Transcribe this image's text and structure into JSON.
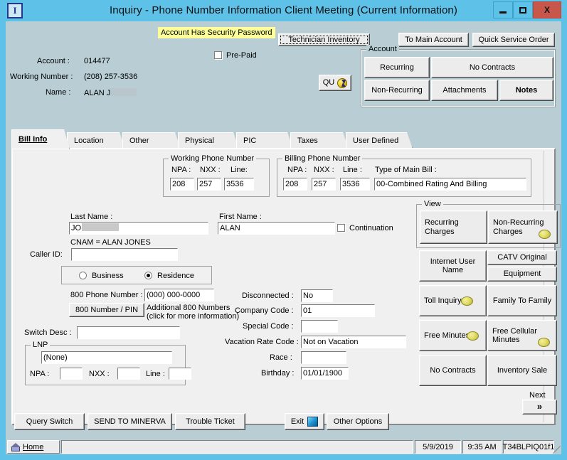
{
  "window": {
    "title": "Inquiry - Phone Number Information    Client Meeting  (Current Information)",
    "app_icon": "I",
    "minimize": "minimize-icon",
    "maximize": "maximize-icon",
    "close": "X"
  },
  "header": {
    "security_banner": "Account Has Security Password",
    "prepaid_label": "Pre-Paid",
    "technician_inventory": "Technician Inventory",
    "to_main_account": "To Main Account",
    "quick_service_order": "Quick Service Order",
    "qu_button": "QU",
    "account_label": "Account :",
    "account_value": "014477",
    "working_number_label": "Working Number :",
    "working_number_value": "(208) 257-3536",
    "name_label": "Name :",
    "name_value": "ALAN J"
  },
  "account_group": {
    "legend": "Account",
    "buttons": [
      "Recurring",
      "No Contracts",
      "Non-Recurring",
      "Attachments",
      "Notes"
    ]
  },
  "tabs": [
    {
      "label": "Bill Info",
      "active": true
    },
    {
      "label": "Location",
      "active": false
    },
    {
      "label": "Other",
      "active": false
    },
    {
      "label": "Physical",
      "active": false
    },
    {
      "label": "PIC",
      "active": false
    },
    {
      "label": "Taxes",
      "active": false
    },
    {
      "label": "User Defined",
      "active": false
    }
  ],
  "working_phone": {
    "legend": "Working Phone Number",
    "npa_label": "NPA :",
    "nxx_label": "NXX :",
    "line_label": "Line:",
    "npa": "208",
    "nxx": "257",
    "line": "3536"
  },
  "billing_phone": {
    "legend": "Billing Phone Number",
    "npa_label": "NPA :",
    "nxx_label": "NXX :",
    "line_label": "Line :",
    "type_label": "Type of Main Bill :",
    "npa": "208",
    "nxx": "257",
    "line": "3536",
    "type_value": "00-Combined Rating And Billing"
  },
  "names": {
    "last_name_label": "Last Name :",
    "last_name_value": "JO",
    "first_name_label": "First Name :",
    "first_name_value": "ALAN",
    "continuation_label": "Continuation",
    "cnam_text": "CNAM = ALAN JONES",
    "caller_id_label": "Caller ID:",
    "caller_id_value": ""
  },
  "class": {
    "business": "Business",
    "residence": "Residence",
    "selected": "Residence"
  },
  "eight_hundred": {
    "phone_label": "800 Phone Number :",
    "phone_value": "(000) 000-0000",
    "pin_button": "800 Number / PIN",
    "note_line1": "Additional 800 Numbers",
    "note_line2": "(click for more information)"
  },
  "switch": {
    "label": "Switch Desc :",
    "value": ""
  },
  "lnp": {
    "legend": "LNP",
    "value": "(None)",
    "npa_label": "NPA :",
    "nxx_label": "NXX :",
    "line_label": "Line :",
    "npa": "",
    "nxx": "",
    "line": ""
  },
  "details": {
    "disconnected_label": "Disconnected :",
    "disconnected_value": "No",
    "company_code_label": "Company Code :",
    "company_code_value": "01",
    "special_code_label": "Special Code :",
    "special_code_value": "",
    "vacation_rate_label": "Vacation Rate Code :",
    "vacation_rate_value": "Not on Vacation",
    "race_label": "Race :",
    "race_value": "",
    "birthday_label": "Birthday :",
    "birthday_value": "01/01/1900"
  },
  "view_group": {
    "legend": "View",
    "recurring_charges": "Recurring Charges",
    "non_recurring_charges": "Non-Recurring Charges"
  },
  "view_buttons": {
    "internet_user_name": "Internet User Name",
    "catv_original": "CATV Original",
    "equipment": "Equipment",
    "toll_inquiry": "Toll Inquiry",
    "family_to_family": "Family To Family",
    "free_minutes": "Free Minutes",
    "free_cellular_minutes": "Free Cellular Minutes",
    "no_contracts": "No Contracts",
    "inventory_sale": "Inventory Sale",
    "next_label": "Next",
    "next_arrows": "»"
  },
  "bottom_bar": {
    "query_switch": "Query Switch",
    "send_to_minerva": "SEND TO MINERVA",
    "trouble_ticket": "Trouble Ticket",
    "exit": "Exit",
    "other_options": "Other Options"
  },
  "status_bar": {
    "home": "Home",
    "message": "",
    "date": "5/9/2019",
    "time": "9:35 AM",
    "terminal": "T34BLPIQ01f1"
  },
  "colors": {
    "titlebar": "#5ec1e8",
    "client": "#b8cdd4",
    "panel": "#f0f0f0",
    "highlight": "#ffff99",
    "close": "#c9564a"
  }
}
